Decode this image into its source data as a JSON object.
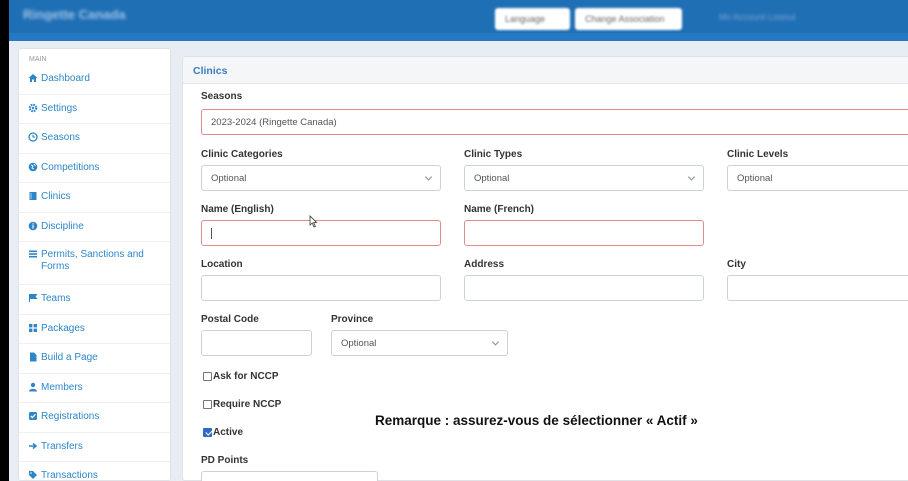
{
  "topbar": {
    "brand": "Ringette Canada",
    "buttons": [
      "Language",
      "Change Association"
    ],
    "right_text": "My Account Logout"
  },
  "sidebar": {
    "section": "MAIN",
    "items": [
      {
        "label": "Dashboard",
        "icon": "home-icon"
      },
      {
        "label": "Settings",
        "icon": "gear-icon"
      },
      {
        "label": "Seasons",
        "icon": "clock-icon"
      },
      {
        "label": "Competitions",
        "icon": "globe-icon"
      },
      {
        "label": "Clinics",
        "icon": "book-icon"
      },
      {
        "label": "Discipline",
        "icon": "info-circle-icon"
      },
      {
        "label": "Permits, Sanctions and Forms",
        "icon": "list-icon"
      },
      {
        "label": "Teams",
        "icon": "flag-icon"
      },
      {
        "label": "Packages",
        "icon": "grid-icon"
      },
      {
        "label": "Build a Page",
        "icon": "file-icon"
      },
      {
        "label": "Members",
        "icon": "user-icon"
      },
      {
        "label": "Registrations",
        "icon": "check-square-icon"
      },
      {
        "label": "Transfers",
        "icon": "arrow-right-icon"
      },
      {
        "label": "Transactions",
        "icon": "tags-icon"
      }
    ]
  },
  "panel": {
    "title": "Clinics",
    "seasons": {
      "label": "Seasons",
      "value": "2023-2024 (Ringette Canada)"
    },
    "categories": {
      "label": "Clinic Categories",
      "value": "Optional"
    },
    "types": {
      "label": "Clinic Types",
      "value": "Optional"
    },
    "levels": {
      "label": "Clinic Levels",
      "value": "Optional"
    },
    "name_en": {
      "label": "Name (English)",
      "value": ""
    },
    "name_fr": {
      "label": "Name (French)",
      "value": ""
    },
    "location": {
      "label": "Location",
      "value": ""
    },
    "address": {
      "label": "Address",
      "value": ""
    },
    "city": {
      "label": "City",
      "value": ""
    },
    "postal_code": {
      "label": "Postal Code",
      "value": ""
    },
    "province": {
      "label": "Province",
      "value": "Optional"
    },
    "ask_nccp": {
      "label": "Ask for NCCP",
      "checked": false
    },
    "require_nccp": {
      "label": "Require NCCP",
      "checked": false
    },
    "active": {
      "label": "Active",
      "checked": true
    },
    "pd_points": {
      "label": "PD Points"
    }
  },
  "note": "Remarque : assurez-vous de sélectionner « Actif »",
  "colors": {
    "accent": "#1f6fb5",
    "link": "#2e86c9",
    "required_border": "#e08a8a",
    "checkbox_on": "#2d6cc0"
  }
}
